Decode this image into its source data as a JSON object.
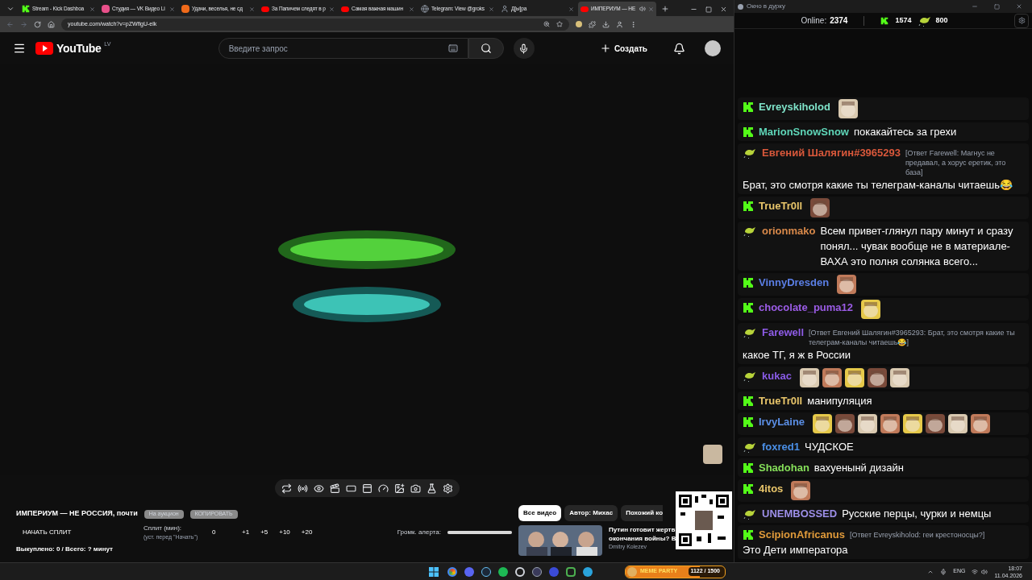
{
  "browser": {
    "tabs": [
      {
        "title": "Stream - Kick Dashboa",
        "kind": "kick",
        "selected": false
      },
      {
        "title": "Студия — VK Видео Li",
        "kind": "vk",
        "selected": false
      },
      {
        "title": "Удачи, веселья, не сд",
        "kind": "movie",
        "selected": false
      },
      {
        "title": "За Папичем следят в р",
        "kind": "video",
        "selected": false
      },
      {
        "title": "Самая важная машин",
        "kind": "video",
        "selected": false
      },
      {
        "title": "Telegram: View @groks",
        "kind": "globe",
        "selected": false
      },
      {
        "title": "Д[ы]ра",
        "kind": "person",
        "selected": false
      },
      {
        "title": "ИМПЕРИУМ — НЕ",
        "kind": "video",
        "selected": true
      }
    ],
    "url": "youtube.com/watch?v=pZWflgU-elk"
  },
  "youtube": {
    "logo": "YouTube",
    "region": "LV",
    "search_placeholder": "Введите запрос",
    "create": "Создать"
  },
  "panel": {
    "title": "ИМПЕРИУМ — НЕ РОССИЯ, почти",
    "buttons": [
      "На аукцион",
      "КОПИРОВАТЬ"
    ],
    "start_split": "НАЧАТЬ СПЛИТ",
    "split_label": "Сплит (мин):",
    "split_hint": "(уст. перед \"Начать\")",
    "split_value": "0",
    "increments": [
      "+1",
      "+5",
      "+10",
      "+20"
    ],
    "alert_label": "Громк. алерта:",
    "alert_volume": {
      "level": 1
    },
    "summary": "Выкуплено: 0 / Всего: ? минут"
  },
  "recommendations": {
    "chips": [
      {
        "label": "Все видео",
        "selected": true
      },
      {
        "label": "Автор: Михас",
        "selected": false
      },
      {
        "label": "Похожий ко",
        "selected": false
      }
    ],
    "video": {
      "title": "Путин готовит жертв",
      "title_line_2": "окончания войны? В",
      "channel": "Dmitry Kolezev"
    }
  },
  "chat": {
    "window_title": "Окно в дурку",
    "online_label": "Online:",
    "online": "2374",
    "kick_count": "1574",
    "other_count": "800",
    "messages": [
      {
        "kind": "kick",
        "user": "Evreyskiholod",
        "color": "#7fe3c9"
      },
      {
        "kind": "kick",
        "user": "MarionSnowSnow",
        "color": "#5fd6b8",
        "text": "покакайтесь за грехи"
      },
      {
        "kind": "duck",
        "user": "Евгений Шалягин#3965293",
        "color": "#d9583b",
        "reply": "[Ответ Farewell: Магнус не предавал, а хорус еретик, это база]",
        "text": "Брат, это смотря какие ты телеграм-каналы читаешь😂"
      },
      {
        "kind": "kick",
        "user": "TrueTr0ll",
        "color": "#e8c56a"
      },
      {
        "kind": "duck",
        "user": "orionmako",
        "color": "#d9894a",
        "text": "Всем привет-глянул пару минут и сразу понял... чувак вообще не в материале-ВАХА это полня солянка всего..."
      },
      {
        "kind": "kick",
        "user": "VinnyDresden",
        "color": "#5b7fe6"
      },
      {
        "kind": "kick",
        "user": "chocolate_puma12",
        "color": "#9b5ce6"
      },
      {
        "kind": "duck",
        "user": "Farewell",
        "color": "#8f5ce8",
        "reply": "[Ответ Евгений Шалягин#3965293: Брат, это смотря какие ты телеграм-каналы читаешь😂]",
        "text": "какое ТГ, я ж в России"
      },
      {
        "kind": "duck",
        "user": "kukac",
        "color": "#8a5ce8"
      },
      {
        "kind": "kick",
        "user": "TrueTr0ll",
        "color": "#e8c56a",
        "text": "манипуляция"
      },
      {
        "kind": "kick",
        "user": "IrvyLaine",
        "color": "#5b8fe6"
      },
      {
        "kind": "duck",
        "user": "foxred1",
        "color": "#4a8fe6",
        "text": "ЧУДСКОЕ"
      },
      {
        "kind": "kick",
        "user": "Shadohan",
        "color": "#86e05a",
        "text": "вахуенынй дизайн"
      },
      {
        "kind": "kick",
        "user": "4itos",
        "color": "#e8c56a"
      },
      {
        "kind": "duck",
        "user": "UNEMBOSSED",
        "color": "#9d8fe8",
        "text": "Русские перцы, чурки и немцы"
      },
      {
        "kind": "kick",
        "user": "ScipionAfricanus",
        "color": "#e09a3a",
        "reply": "[Ответ Evreyskiholod: геи крестоносцы?]",
        "text": "Это Дети императора"
      }
    ]
  },
  "taskbar": {
    "meme": {
      "title": "MEME PARTY",
      "progress": "1122 / 1500",
      "level": 0.75
    },
    "language": "ENG",
    "time": "18:07",
    "date": "11.04.2026"
  }
}
